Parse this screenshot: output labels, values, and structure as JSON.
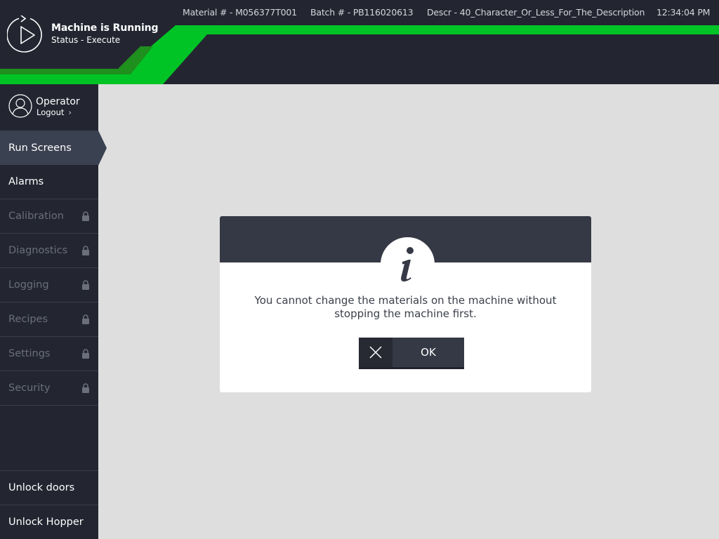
{
  "status": {
    "title": "Machine is Running",
    "subtitle": "Status - Execute",
    "icon": "play-icon"
  },
  "info_bar": {
    "material": "Material # - M056377T001",
    "batch": "Batch # - PB116020613",
    "description": "Descr - 40_Character_Or_Less_For_The_Description",
    "time": "12:34:04 PM"
  },
  "user": {
    "name": "Operator",
    "logout_label": "Logout",
    "icon": "user-icon"
  },
  "nav": {
    "items": [
      {
        "label": "Run Screens",
        "active": true,
        "locked": false
      },
      {
        "label": "Alarms",
        "active": false,
        "locked": false
      },
      {
        "label": "Calibration",
        "active": false,
        "locked": true
      },
      {
        "label": "Diagnostics",
        "active": false,
        "locked": true
      },
      {
        "label": "Logging",
        "active": false,
        "locked": true
      },
      {
        "label": "Recipes",
        "active": false,
        "locked": true
      },
      {
        "label": "Settings",
        "active": false,
        "locked": true
      },
      {
        "label": "Security",
        "active": false,
        "locked": true
      }
    ],
    "bottom": [
      {
        "label": "Unlock doors"
      },
      {
        "label": "Unlock Hopper"
      }
    ]
  },
  "dialog": {
    "icon": "info-icon",
    "message": "You cannot change the materials on the machine without stopping the machine first.",
    "ok_label": "OK",
    "close_icon": "close-icon"
  },
  "colors": {
    "accent_green": "#00c426",
    "dark_green": "#1f9a20",
    "panel_dark": "#232631",
    "active_nav": "#3a4150",
    "content_bg": "#dedede"
  }
}
